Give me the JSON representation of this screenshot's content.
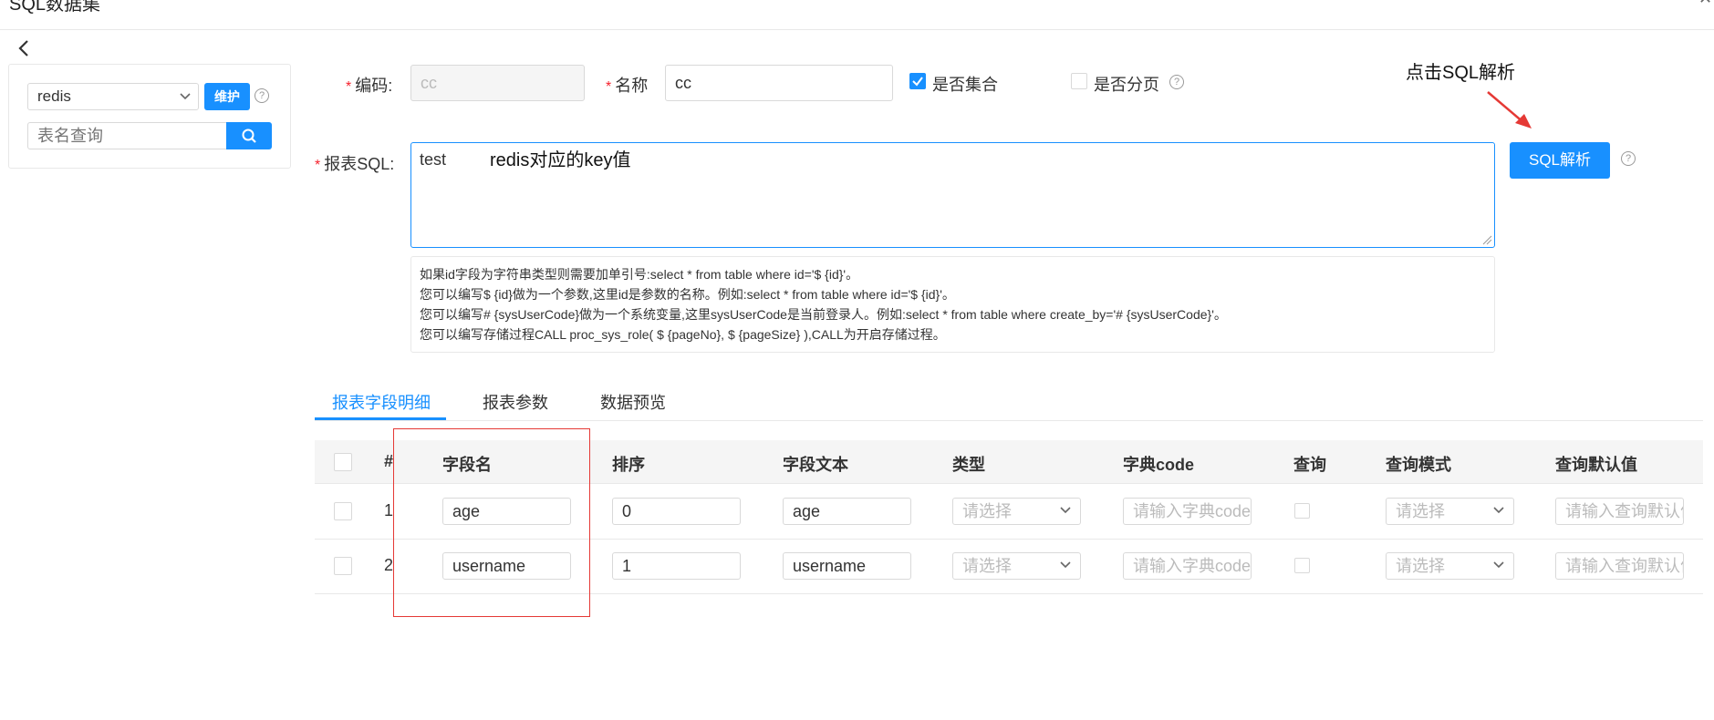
{
  "header": {
    "title": "SQL数据集",
    "close_label": "✕"
  },
  "left_panel": {
    "datasource_value": "redis",
    "maintain_label": "维护",
    "help_label": "?",
    "table_search_placeholder": "表名查询"
  },
  "form": {
    "code_label": "编码:",
    "code_value": "cc",
    "name_label": "名称",
    "name_value": "cc",
    "is_collection_label": "是否集合",
    "is_collection_checked": true,
    "is_paging_label": "是否分页",
    "is_paging_checked": false,
    "sql_label": "报表SQL:",
    "sql_value": "test",
    "sql_parse_label": "SQL解析",
    "hints": [
      "如果id字段为字符串类型则需要加单引号:select * from table where id='$ {id}'。",
      "您可以编写$ {id}做为一个参数,这里id是参数的名称。例如:select * from table where id='$ {id}'。",
      "您可以编写# {sysUserCode}做为一个系统变量,这里sysUserCode是当前登录人。例如:select * from table where create_by='# {sysUserCode}'。",
      "您可以编写存储过程CALL proc_sys_role( $ {pageNo}, $ {pageSize} ),CALL为开启存储过程。"
    ]
  },
  "annotations": {
    "click_parse": "点击SQL解析",
    "redis_key": "redis对应的key值"
  },
  "tabs": [
    {
      "label": "报表字段明细",
      "active": true
    },
    {
      "label": "报表参数",
      "active": false
    },
    {
      "label": "数据预览",
      "active": false
    }
  ],
  "table": {
    "headers": [
      "#",
      "字段名",
      "排序",
      "字段文本",
      "类型",
      "字典code",
      "查询",
      "查询模式",
      "查询默认值"
    ],
    "rows": [
      {
        "num": "1",
        "field_name": "age",
        "order": "0",
        "field_text": "age"
      },
      {
        "num": "2",
        "field_name": "username",
        "order": "1",
        "field_text": "username"
      }
    ],
    "type_placeholder": "请选择",
    "dict_placeholder": "请输入字典code",
    "mode_placeholder": "请选择",
    "default_placeholder": "请输入查询默认值"
  },
  "colors": {
    "primary": "#1890ff",
    "required": "#f5222d",
    "annotation_red": "#e53935"
  }
}
